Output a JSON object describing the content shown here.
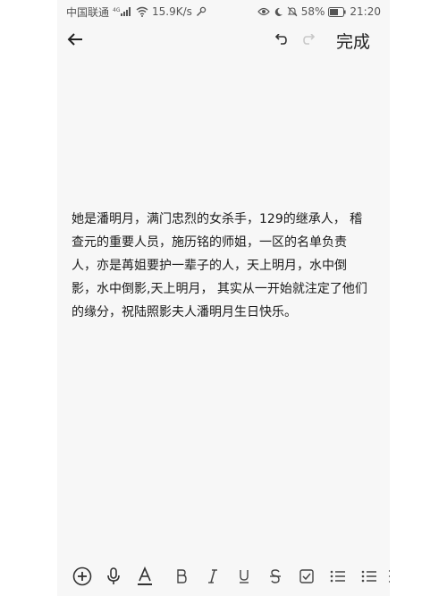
{
  "status_bar": {
    "carrier": "中国联通",
    "network_type": "4G",
    "speed": "15.9K/s",
    "battery_percent": "58%",
    "time": "21:20"
  },
  "header": {
    "done_label": "完成"
  },
  "note": {
    "lines": [
      "她是潘明月，满门忠烈的女杀手，129的继承人， 稽",
      "查元的重要人员，施历铭的师姐，一区的名单负责",
      "人，亦是苒姐要护一辈子的人，天上明月，水中倒",
      "影，水中倒影,天上明月， 其实从一开始就注定了他们",
      "的缘分，祝陆照影夫人潘明月生日快乐。"
    ]
  },
  "toolbar": {
    "items": [
      {
        "name": "insert-button",
        "icon": "plus-circle-icon"
      },
      {
        "name": "voice-button",
        "icon": "microphone-icon"
      },
      {
        "name": "font-color-button",
        "icon": "text-color-icon"
      },
      {
        "name": "bold-button",
        "icon": "bold-icon"
      },
      {
        "name": "italic-button",
        "icon": "italic-icon"
      },
      {
        "name": "underline-button",
        "icon": "underline-icon"
      },
      {
        "name": "strikethrough-button",
        "icon": "strikethrough-icon"
      },
      {
        "name": "checkbox-button",
        "icon": "checkbox-icon"
      },
      {
        "name": "numbered-list-button",
        "icon": "numbered-list-icon"
      },
      {
        "name": "bullet-list-button",
        "icon": "bullet-list-icon"
      },
      {
        "name": "more-button",
        "icon": "more-icon"
      }
    ]
  }
}
